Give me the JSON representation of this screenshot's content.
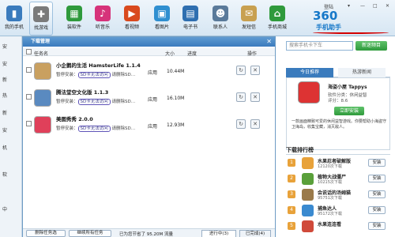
{
  "top_nav": [
    {
      "label": "我的手机",
      "icon": "phone-icon",
      "color": "#3a7bbd"
    },
    {
      "label": "找游戏",
      "icon": "gamepad-icon",
      "color": "#7a7a7a"
    },
    {
      "label": "装软件",
      "icon": "apps-grid-icon",
      "color": "#2f9a3c"
    },
    {
      "label": "听音乐",
      "icon": "music-icon",
      "color": "#d6337a"
    },
    {
      "label": "看视频",
      "icon": "video-icon",
      "color": "#d94a1e"
    },
    {
      "label": "看图片",
      "icon": "picture-icon",
      "color": "#2f8fd0"
    },
    {
      "label": "电子书",
      "icon": "ebook-icon",
      "color": "#2f6fb0"
    },
    {
      "label": "联系人",
      "icon": "contacts-icon",
      "color": "#5a7a9a"
    },
    {
      "label": "发短信",
      "icon": "envelope-icon",
      "color": "#c8a050"
    },
    {
      "label": "手机商城",
      "icon": "cart-icon",
      "color": "#2f9a3c"
    }
  ],
  "window_controls": {
    "login": "登陆"
  },
  "logo": {
    "line1": "360",
    "line2": "手机助手"
  },
  "sidebar": {
    "items": [
      "安",
      "安",
      "新",
      "热",
      "新",
      "安",
      "机",
      "",
      "软",
      "",
      "中"
    ]
  },
  "download_manager": {
    "title": "下载管理",
    "columns": {
      "name": "任务名",
      "size": "大小",
      "progress": "进度",
      "ops": "操作"
    },
    "rows": [
      {
        "name": "小企鹅的生活 HamsterLife 1.1.4",
        "status_prefix": "暂停安装：",
        "error": "SD卡无法访问",
        "status_suffix": "请删除SD…",
        "type": "应用",
        "size": "10.44M"
      },
      {
        "name": "腾法堂空文化版 1.1.3",
        "status_prefix": "暂停安装：",
        "error": "SD卡无法访问",
        "status_suffix": "请删除SD…",
        "type": "应用",
        "size": "16.10M"
      },
      {
        "name": "美图秀秀 2.0.0",
        "status_prefix": "暂停安装：",
        "error": "SD卡无法访问",
        "status_suffix": "请删除SD…",
        "type": "应用",
        "size": "12.93M"
      }
    ],
    "bottom": {
      "pause_all": "删除任务选",
      "continue_all": "继续所有任务",
      "saved": "已为您节省了 95.20M 流量",
      "downloading": "进行中(3)",
      "completed": "已完成(4)"
    }
  },
  "right_panel": {
    "search_placeholder": "搜索手机卡下车",
    "search_button": "新迷频目",
    "tabs": [
      "今日推荐",
      "热游新闻"
    ],
    "featured": {
      "title": "海盗小屋 Tappys",
      "sub": "软件分类：休闲益智",
      "score": "评分：8.6",
      "install": "立即安装",
      "desc": "一款画面精致可爱的休闲益智游戏。你要帮助小海盗守卫海岛，收集宝藏，消灭敌人。"
    },
    "rank_title": "下载排行榜",
    "rank": [
      {
        "num": "1",
        "name": "水果忍者破解版",
        "downloads": "12120次下载",
        "btn": "安装",
        "color": "#e8a23a"
      },
      {
        "num": "2",
        "name": "植物大战僵尸",
        "downloads": "10215次下载",
        "btn": "安装",
        "color": "#5aa03a"
      },
      {
        "num": "3",
        "name": "会说话的汤姆猫",
        "downloads": "95751次下载",
        "btn": "安装",
        "color": "#9a7a4a"
      },
      {
        "num": "4",
        "name": "捕鱼达人",
        "downloads": "95172次下载",
        "btn": "安装",
        "color": "#3a8ad0"
      },
      {
        "num": "5",
        "name": "水果连连看",
        "downloads": "",
        "btn": "安装",
        "color": "#d04a3a"
      }
    ]
  }
}
